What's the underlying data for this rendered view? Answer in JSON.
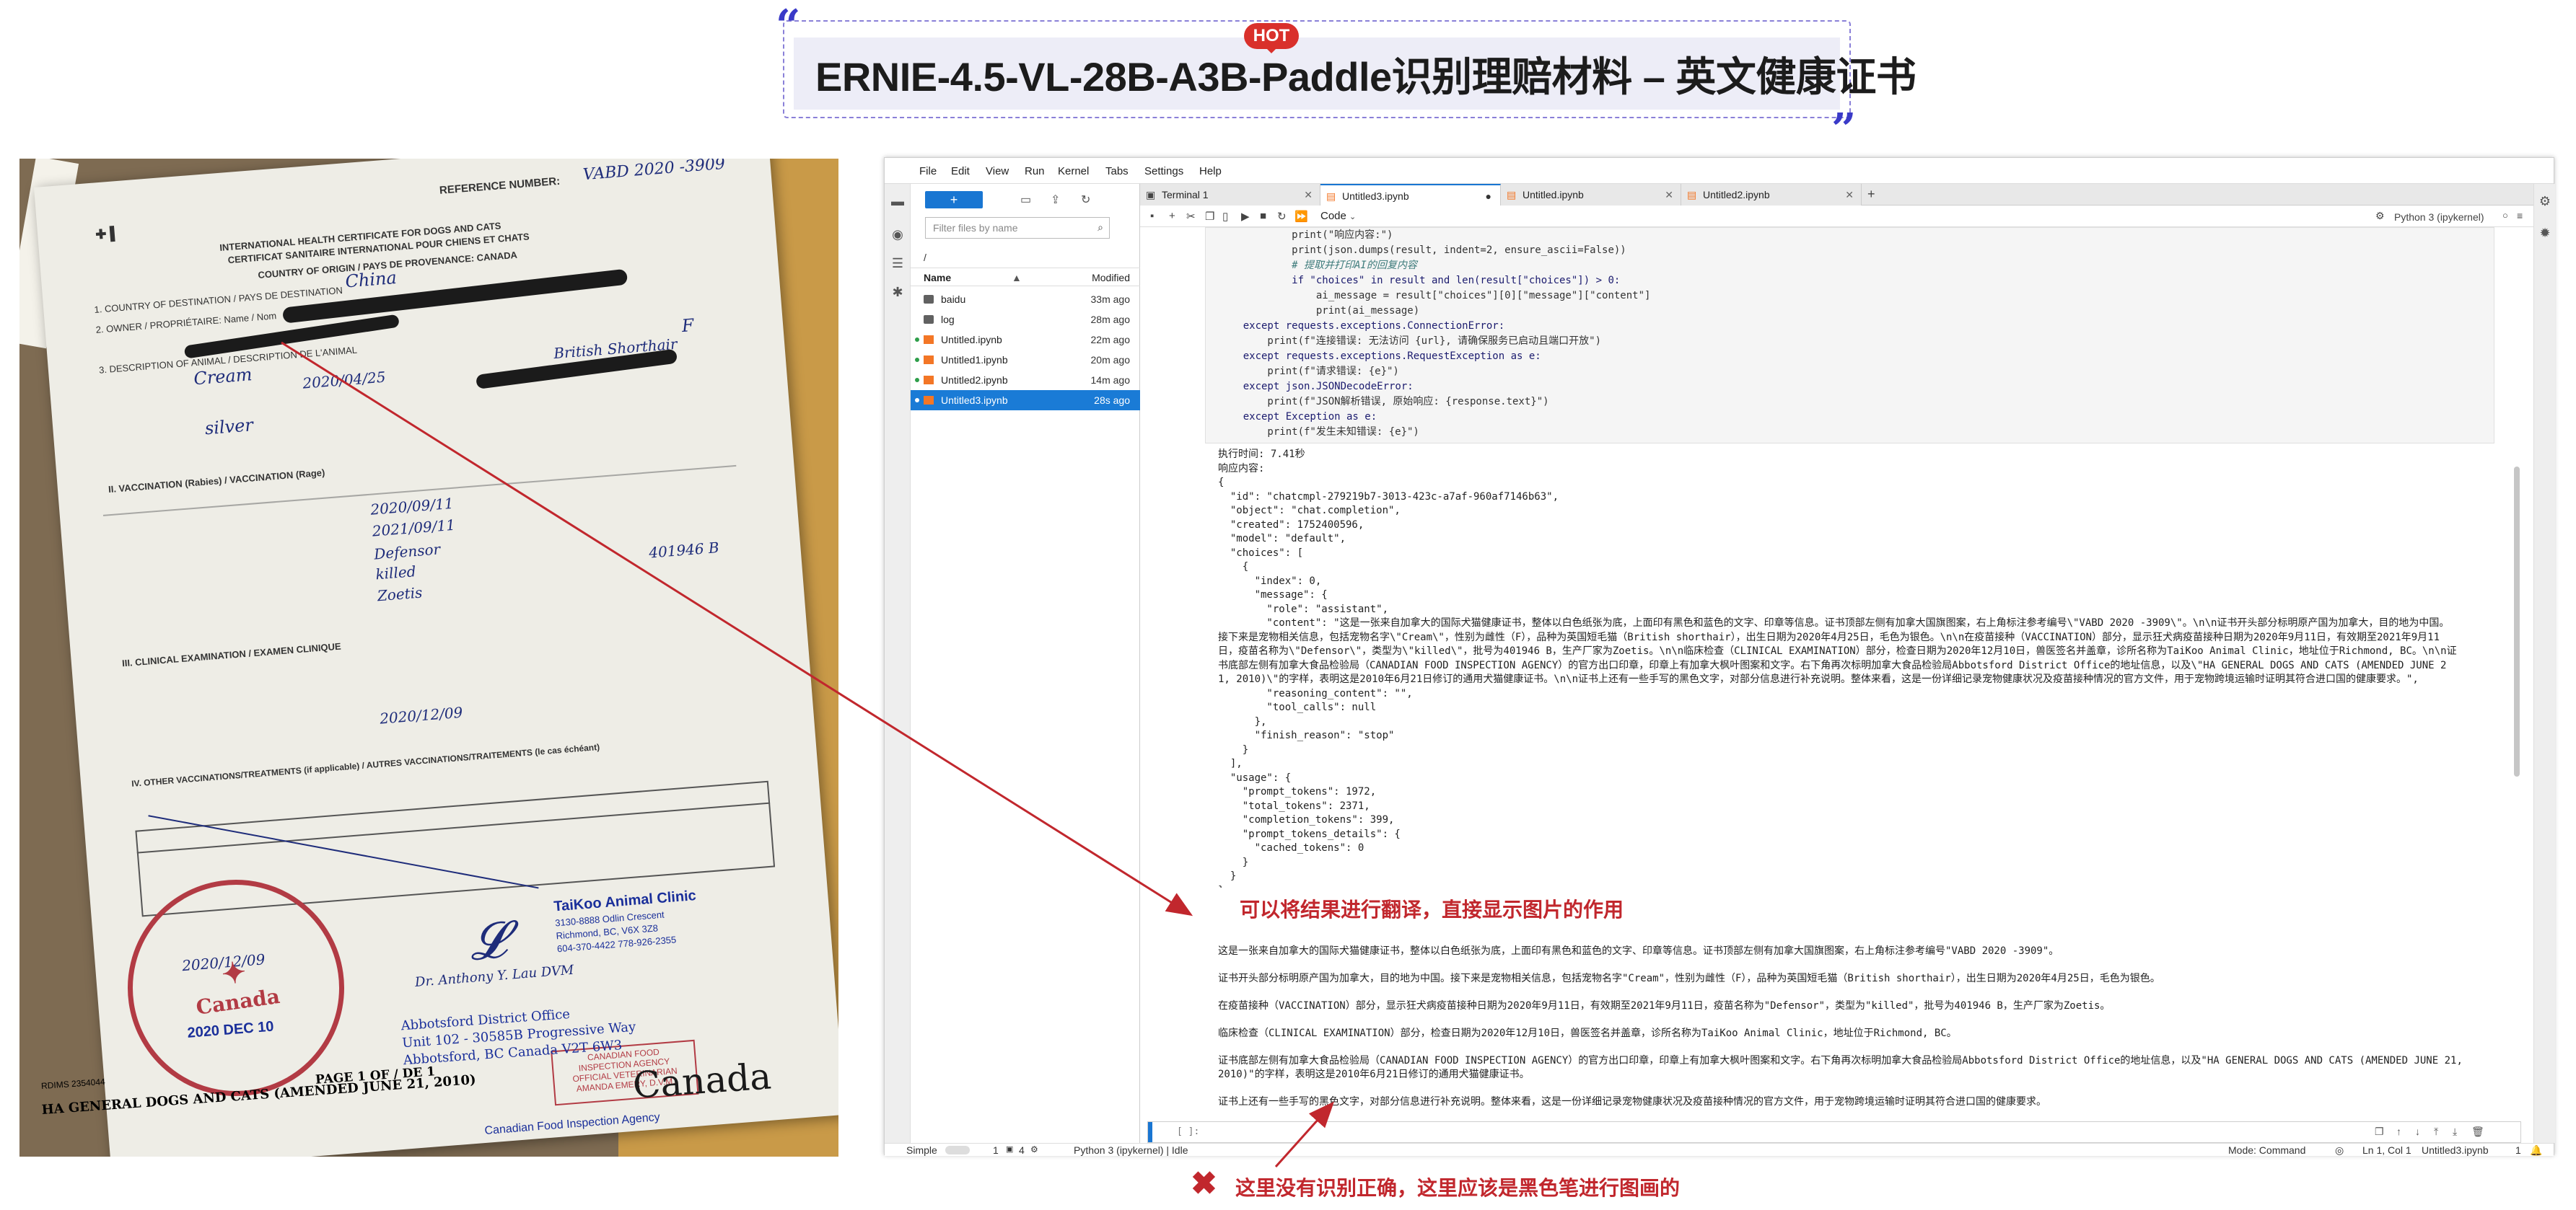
{
  "header": {
    "title": "ERNIE-4.5-VL-28B-A3B-Paddle识别理赔材料 – 英文健康证书",
    "hot_badge": "HOT",
    "open_quote": "“",
    "close_quote": "”"
  },
  "photo": {
    "reference_label": "REFERENCE NUMBER:",
    "reference_number": "VABD 2020 -3909",
    "cert_title_en": "INTERNATIONAL HEALTH CERTIFICATE FOR DOGS AND CATS",
    "cert_title_fr": "CERTIFICAT SANITAIRE INTERNATIONAL POUR CHIENS ET CHATS",
    "country_origin": "COUNTRY OF ORIGIN / PAYS DE PROVENANCE: CANADA",
    "destination_label": "1. COUNTRY OF DESTINATION / PAYS DE DESTINATION",
    "destination_value": "China",
    "owner_label": "2. OWNER / PROPRIÉTAIRE: Name / Nom",
    "animal_label": "3. DESCRIPTION OF ANIMAL / DESCRIPTION DE L'ANIMAL",
    "animal_name": "Cream",
    "dob": "2020/04/25",
    "sex": "F",
    "breed": "British Shorthair",
    "colour": "silver",
    "vaccination_label": "II. VACCINATION (Rabies) / VACCINATION (Rage)",
    "vacc_date": "2020/09/11",
    "vacc_valid": "2021/09/11",
    "vaccine_name": "Defensor",
    "vaccine_type": "killed",
    "batch": "401946 B",
    "manufacturer": "Zoetis",
    "clinical_label": "III. CLINICAL EXAMINATION / EXAMEN CLINIQUE",
    "clinical_date": "2020/12/09",
    "other_vacc_label": "IV. OTHER VACCINATIONS/TREATMENTS (if applicable) / AUTRES VACCINATIONS/TRAITEMENTS (le cas échéant)",
    "sign_date": "2020/12/09",
    "clinic_name": "TaiKoo Animal Clinic",
    "clinic_addr1": "3130-8888 Odlin Crescent",
    "clinic_addr2": "Richmond, BC, V6X 3Z8",
    "clinic_phone": "604-370-4422  778-926-2355",
    "vet_name": "Dr. Anthony Y. Lau  DVM",
    "cfia_date": "2020 DEC 10",
    "stamp_line1": "CANADIAN FOOD",
    "stamp_line2": "INSPECTION AGENCY",
    "stamp_line3": "OFFICIAL VETERINARIAN",
    "stamp_line4": "AMANDA EMERY, D.V.M.",
    "seal_text": "Canada",
    "office_line1": "Canadian Food Inspection Agency",
    "office_line2": "Abbotsford District Office",
    "office_line3": "Unit 102 - 30585B Progressive Way",
    "office_line4": "Abbotsford, BC  Canada  V2T 6W3",
    "page_label": "PAGE 1 OF / DE 1",
    "footer": "HA GENERAL DOGS AND CATS (AMENDED JUNE 21, 2010)",
    "rdims": "RDIMS 2354044",
    "wordmark": "Canada"
  },
  "jupyter": {
    "menus": [
      "File",
      "Edit",
      "View",
      "Run",
      "Kernel",
      "Tabs",
      "Settings",
      "Help"
    ],
    "new_button": "+",
    "filter_placeholder": "Filter files by name",
    "breadcrumb": "/",
    "col_name": "Name",
    "col_modified": "Modified",
    "files": [
      {
        "name": "baidu",
        "modified": "33m ago",
        "kind": "folder",
        "running": false,
        "selected": false
      },
      {
        "name": "log",
        "modified": "28m ago",
        "kind": "folder",
        "running": false,
        "selected": false
      },
      {
        "name": "Untitled.ipynb",
        "modified": "22m ago",
        "kind": "notebook",
        "running": true,
        "selected": false
      },
      {
        "name": "Untitled1.ipynb",
        "modified": "20m ago",
        "kind": "notebook",
        "running": true,
        "selected": false
      },
      {
        "name": "Untitled2.ipynb",
        "modified": "14m ago",
        "kind": "notebook",
        "running": true,
        "selected": false
      },
      {
        "name": "Untitled3.ipynb",
        "modified": "28s ago",
        "kind": "notebook",
        "running": true,
        "selected": true
      }
    ],
    "tabs": [
      {
        "label": "Terminal 1",
        "active": false
      },
      {
        "label": "Untitled3.ipynb",
        "active": true
      },
      {
        "label": "Untitled.ipynb",
        "active": false
      },
      {
        "label": "Untitled2.ipynb",
        "active": false
      }
    ],
    "cell_type": "Code",
    "kernel_name": "Python 3 (ipykernel)",
    "code_lines": [
      "            print(\"响应内容:\")",
      "            print(json.dumps(result, indent=2, ensure_ascii=False))",
      "",
      "            # 提取并打印AI的回复内容",
      "            if \"choices\" in result and len(result[\"choices\"]) > 0:",
      "                ai_message = result[\"choices\"][0][\"message\"][\"content\"]",
      "                print(ai_message)",
      "",
      "    except requests.exceptions.ConnectionError:",
      "        print(f\"连接错误: 无法访问 {url}, 请确保服务已启动且端口开放\")",
      "    except requests.exceptions.RequestException as e:",
      "        print(f\"请求错误: {e}\")",
      "    except json.JSONDecodeError:",
      "        print(f\"JSON解析错误, 原始响应: {response.text}\")",
      "    except Exception as e:",
      "        print(f\"发生未知错误: {e}\")"
    ],
    "output_json": "执行时间: 7.41秒\n响应内容:\n{\n  \"id\": \"chatcmpl-279219b7-3013-423c-a7af-960af7146b63\",\n  \"object\": \"chat.completion\",\n  \"created\": 1752400596,\n  \"model\": \"default\",\n  \"choices\": [\n    {\n      \"index\": 0,\n      \"message\": {\n        \"role\": \"assistant\",\n        \"content\": \"这是一张来自加拿大的国际犬猫健康证书，整体以白色纸张为底，上面印有黑色和蓝色的文字、印章等信息。证书顶部左侧有加拿大国旗图案，右上角标注参考编号\\\"VABD 2020 -3909\\\"。\\n\\n证书开头部分标明原产国为加拿大，目的地为中国。\n接下来是宠物相关信息，包括宠物名字\\\"Cream\\\"，性别为雌性（F），品种为英国短毛猫（British shorthair），出生日期为2020年4月25日，毛色为银色。\\n\\n在疫苗接种（VACCINATION）部分，显示狂犬病疫苗接种日期为2020年9月11日，有效期至2021年9月11\n日，疫苗名称为\\\"Defensor\\\"，类型为\\\"killed\\\"，批号为401946 B，生产厂家为Zoetis。\\n\\n临床检查（CLINICAL EXAMINATION）部分，检查日期为2020年12月10日，兽医签名并盖章，诊所名称为TaiKoo Animal Clinic，地址位于Richmond, BC。\\n\\n证\n书底部左侧有加拿大食品检验局（CANADIAN FOOD INSPECTION AGENCY）的官方出口印章，印章上有加拿大枫叶图案和文字。右下角再次标明加拿大食品检验局Abbotsford District Office的地址信息，以及\\\"HA GENERAL DOGS AND CATS (AMENDED JUNE 2\n1, 2010)\\\"的字样，表明这是2010年6月21日修订的通用犬猫健康证书。\\n\\n证书上还有一些手写的黑色文字，对部分信息进行补充说明。整体来看，这是一份详细记录宠物健康状况及疫苗接种情况的官方文件，用于宠物跨境运输时证明其符合进口国的健康要求。\",\n        \"reasoning_content\": \"\",\n        \"tool_calls\": null\n      },\n      \"finish_reason\": \"stop\"\n    }\n  ],\n  \"usage\": {\n    \"prompt_tokens\": 1972,\n    \"total_tokens\": 2371,\n    \"completion_tokens\": 399,\n    \"prompt_tokens_details\": {\n      \"cached_tokens\": 0\n    }\n  }\n}",
    "output_text": [
      "这是一张来自加拿大的国际犬猫健康证书，整体以白色纸张为底，上面印有黑色和蓝色的文字、印章等信息。证书顶部左侧有加拿大国旗图案，右上角标注参考编号\"VABD 2020 -3909\"。",
      "证书开头部分标明原产国为加拿大，目的地为中国。接下来是宠物相关信息，包括宠物名字\"Cream\"，性别为雌性（F），品种为英国短毛猫（British shorthair），出生日期为2020年4月25日，毛色为银色。",
      "在疫苗接种（VACCINATION）部分，显示狂犬病疫苗接种日期为2020年9月11日，有效期至2021年9月11日，疫苗名称为\"Defensor\"，类型为\"killed\"，批号为401946 B，生产厂家为Zoetis。",
      "临床检查（CLINICAL EXAMINATION）部分，检查日期为2020年12月10日，兽医签名并盖章，诊所名称为TaiKoo Animal Clinic，地址位于Richmond, BC。",
      "证书底部左侧有加拿大食品检验局（CANADIAN FOOD INSPECTION AGENCY）的官方出口印章，印章上有加拿大枫叶图案和文字。右下角再次标明加拿大食品检验局Abbotsford District Office的地址信息，以及\"HA GENERAL DOGS AND CATS (AMENDED JUNE 21, 2010)\"的字样，表明这是2010年6月21日修订的通用犬猫健康证书。",
      "证书上还有一些手写的黑色文字，对部分信息进行补充说明。整体来看，这是一份详细记录宠物健康状况及疫苗接种情况的官方文件，用于宠物跨境运输时证明其符合进口国的健康要求。"
    ],
    "input_prompt": "[ ]:",
    "status": {
      "mode_toggle": "Simple",
      "count1": "1",
      "count2": "4",
      "kernel_status": "Python 3 (ipykernel) | Idle",
      "mode": "Mode: Command",
      "cursor": "Ln 1, Col 1",
      "file": "Untitled3.ipynb",
      "notif": "1"
    }
  },
  "annotations": {
    "translate_note": "可以将结果进行翻译，直接显示图片的作用",
    "error_note": "这里没有识别正确，这里应该是黑色笔进行图画的",
    "accent": "#c1272d"
  }
}
